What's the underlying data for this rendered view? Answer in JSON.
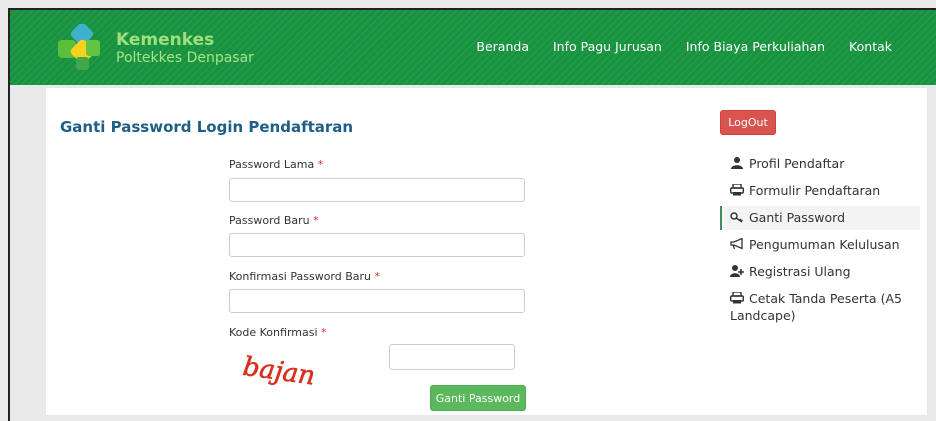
{
  "header": {
    "brand_name": "Kemenkes",
    "brand_sub": "Poltekkes Denpasar",
    "nav": [
      "Beranda",
      "Info Pagu Jurusan",
      "Info Biaya Perkuliahan",
      "Kontak"
    ]
  },
  "form": {
    "title": "Ganti Password Login Pendaftaran",
    "old_password_label": "Password Lama",
    "new_password_label": "Password Baru",
    "confirm_password_label": "Konfirmasi Password Baru",
    "captcha_label": "Kode Konfirmasi",
    "required_mark": "*",
    "captcha_text": "bajan",
    "submit_label": "Ganti Password"
  },
  "sidebar": {
    "logout_label": "LogOut",
    "items": [
      {
        "label": "Profil Pendaftar",
        "icon": "user-icon"
      },
      {
        "label": "Formulir Pendaftaran",
        "icon": "printer-icon"
      },
      {
        "label": "Ganti Password",
        "icon": "key-icon",
        "active": true
      },
      {
        "label": "Pengumuman Kelulusan",
        "icon": "bullhorn-icon"
      },
      {
        "label": "Registrasi Ulang",
        "icon": "user-add-icon"
      },
      {
        "label": "Cetak Tanda Peserta (A5 Landcape)",
        "icon": "printer-icon"
      }
    ]
  },
  "colors": {
    "navbar": "#17923e",
    "title": "#1f5e86",
    "logout": "#d9534f",
    "submit": "#5cb85c",
    "required": "#e02a2a"
  }
}
